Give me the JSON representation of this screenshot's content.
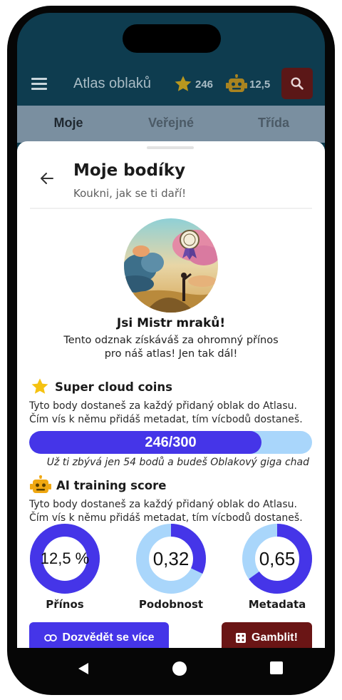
{
  "app": {
    "title": "Atlas oblaků",
    "stars": "246",
    "ai_score": "12,5"
  },
  "tabs": [
    {
      "label": "Moje",
      "active": true
    },
    {
      "label": "Veřejné",
      "active": false
    },
    {
      "label": "Třída",
      "active": false
    }
  ],
  "sheet": {
    "title": "Moje bodíky",
    "subtitle": "Koukni, jak se ti daří!"
  },
  "badge": {
    "title": "Jsi Mistr mraků!",
    "description": "Tento odznak získáváš za ohromný přínos pro náš atlas! Jen tak dál!"
  },
  "coins": {
    "heading": "Super cloud coins",
    "description": "Tyto body dostaneš za každý přidaný oblak do Atlasu. Čím vís k němu přidáš metadat, tím vícbodů dostaneš.",
    "progress_label": "246/300",
    "progress_value": 246,
    "progress_max": 300,
    "note": "Už ti zbývá jen 54 bodů a budeš Oblakový giga chad"
  },
  "ai": {
    "heading": "AI training score",
    "description": "Tyto body dostaneš za každý přidaný oblak do Atlasu. Čím vís k němu přidáš metadat, tím vícbodů dostaneš.",
    "rings": [
      {
        "label": "Přínos",
        "value_text": "12,5 %",
        "fraction": 1.0
      },
      {
        "label": "Podobnost",
        "value_text": "0,32",
        "fraction": 0.32
      },
      {
        "label": "Metadata",
        "value_text": "0,65",
        "fraction": 0.65
      }
    ]
  },
  "buttons": {
    "learn_more": "Dozvědět se více",
    "gamble": "Gamblit!"
  },
  "colors": {
    "primary": "#4535e8",
    "ring_track": "#a9d6fb",
    "danger": "#6a1515",
    "appbar": "#0e3c4f",
    "tabs": "#7a8fa0"
  }
}
